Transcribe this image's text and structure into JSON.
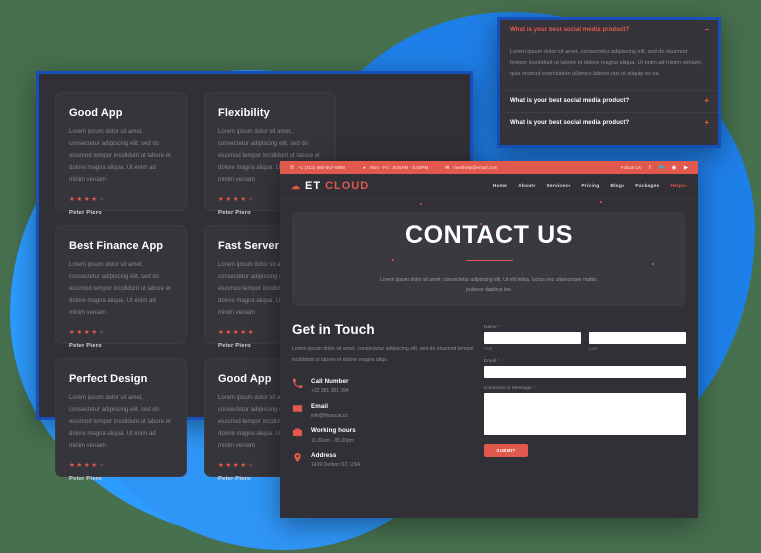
{
  "background": {
    "page_color": "#47704f",
    "blob_colors": [
      "#1f7fe8",
      "#2d9bff",
      "#2f96f7"
    ],
    "accent": "#e1594c",
    "panel_bg": "#313036",
    "border_blue": "#1650b8"
  },
  "faq_panel": {
    "items": [
      {
        "question": "What is your best social media product?",
        "toggle": "−",
        "expanded": true,
        "answer": "Lorem ipsum dolor sit amet, consectetur adipiscing elit, sed do eiusmod tempor incididunt ut labore et dolore magna aliqua. Ut enim ad minim veniam, quis nostrud exercitation ullamco laboris nisi ut aliquip ex ea"
      },
      {
        "question": "What is your best social media product?",
        "toggle": "+",
        "expanded": false,
        "answer": ""
      },
      {
        "question": "What is your best social media product?",
        "toggle": "+",
        "expanded": false,
        "answer": ""
      }
    ]
  },
  "cards_panel": {
    "cards": [
      {
        "title": "Good App",
        "text": "Lorem ipsum dolor sit amet, consectetur adipiscing elit, sed do eiusmod tempor incididunt ut labore et dolore magna aliqua. Ut enim ad minim veniam",
        "rating": 4.5,
        "author": "Peter Piero"
      },
      {
        "title": "Flexibility",
        "text": "Lorem ipsum dolor sit amet, consectetur adipiscing elit, sed do eiusmod tempor incididunt ut labore et dolore magna aliqua. Ut enim ad minim veniam",
        "rating": 4.5,
        "author": "Peter Piero"
      },
      {
        "title": "Best Finance App",
        "text": "Lorem ipsum dolor sit amet, consectetur adipiscing elit, sed do eiusmod tempor incididunt ut labore et dolore magna aliqua. Ut enim ad minim veniam",
        "rating": 4.5,
        "author": "Peter Piero"
      },
      {
        "title": "Fast Server",
        "text": "Lorem ipsum dolor sit amet, consectetur adipiscing elit, sed do eiusmod tempor incididunt ut labore et dolore magna aliqua. Ut enim ad minim veniam",
        "rating": 5,
        "author": "Peter Piero"
      },
      {
        "title": "Perfect Design",
        "text": "Lorem ipsum dolor sit amet, consectetur adipiscing elit, sed do eiusmod tempor incididunt ut labore et dolore magna aliqua. Ut enim ad minim veniam",
        "rating": 4.5,
        "author": "Peter Piero"
      },
      {
        "title": "Good App",
        "text": "Lorem ipsum dolor sit amet, consectetur adipiscing elit, sed do eiusmod tempor incididunt ut labore et dolore magna aliqua. Ut enim ad minim veniam",
        "rating": 4.5,
        "author": "Peter Piero"
      }
    ]
  },
  "site": {
    "topbar": {
      "phone": "+1 (212) 880-567-8890",
      "hours": "Mon - Fri : 8:00AM - 5:00PM",
      "email": "needhelp@email.com",
      "follow_label": "Follow Us",
      "socials": [
        "facebook-icon",
        "twitter-icon",
        "instagram-icon",
        "youtube-icon"
      ]
    },
    "brand": {
      "logo_icon": "cloud-icon",
      "name_first": "ET",
      "name_second": "CLOUD"
    },
    "nav": [
      {
        "label": "Home",
        "dropdown": false,
        "active": false
      },
      {
        "label": "About",
        "dropdown": true,
        "active": false
      },
      {
        "label": "Services",
        "dropdown": true,
        "active": false
      },
      {
        "label": "Pricing",
        "dropdown": false,
        "active": false
      },
      {
        "label": "Blog",
        "dropdown": true,
        "active": false
      },
      {
        "label": "Packages",
        "dropdown": false,
        "active": false
      },
      {
        "label": "Helps",
        "dropdown": true,
        "active": true
      }
    ],
    "hero": {
      "title": "CONTACT US",
      "subtitle": "Lorem ipsum dolor sit amet, consectetur adipiscing elit. Ut elit tellus, luctus nec ullamcorper mattis, pulvinar dapibus leo."
    },
    "get_in_touch": {
      "title": "Get in Touch",
      "text": "Lorem ipsum dolor sit amet, consectetur adipiscing elit, sed do eiusmod tempor incididunt ut labore et dolore magna aliqu",
      "contacts": [
        {
          "icon": "phone-icon",
          "label": "Call Number",
          "value": "+32 381 381 394"
        },
        {
          "icon": "envelope-icon",
          "label": "Email",
          "value": "info@financia.co"
        },
        {
          "icon": "clock-icon",
          "label": "Working hours",
          "value": "11.00am - 05.00pm"
        },
        {
          "icon": "map-marker-icon",
          "label": "Address",
          "value": "1439 Derbon ST, USA"
        }
      ]
    },
    "form": {
      "name_label": "Name",
      "first_sub": "First",
      "last_sub": "Last",
      "email_label": "Email",
      "message_label": "Comment or Message",
      "required_mark": "*",
      "first_value": "",
      "last_value": "",
      "email_value": "",
      "message_value": "",
      "submit_label": "SUBMIT"
    }
  }
}
